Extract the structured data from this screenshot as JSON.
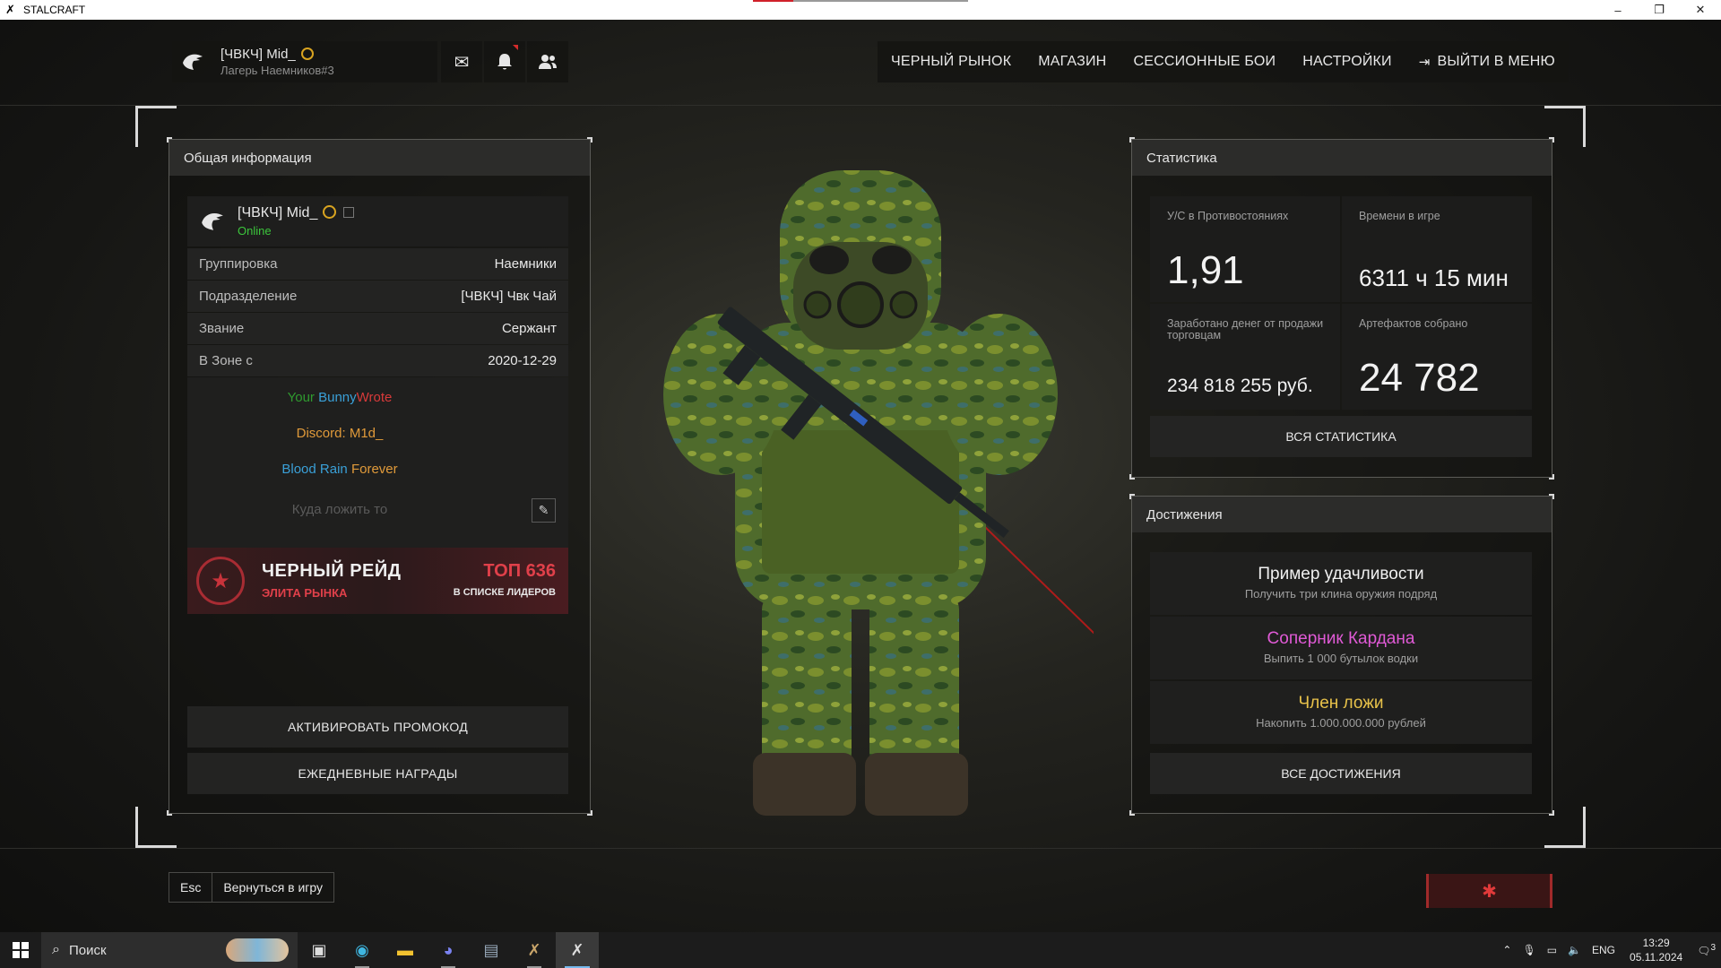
{
  "window": {
    "title": "STALCRAFT",
    "minimize": "–",
    "maximize": "❐",
    "close": "✕"
  },
  "header": {
    "player_name": "[ЧВКЧ] Mid_",
    "location": "Лагерь Наемников#3",
    "nav": [
      "ЧЕРНЫЙ РЫНОК",
      "МАГАЗИН",
      "СЕССИОННЫЕ БОИ",
      "НАСТРОЙКИ",
      "ВЫЙТИ В МЕНЮ"
    ]
  },
  "general": {
    "title": "Общая информация",
    "name": "[ЧВКЧ] Mid_",
    "status": "Online",
    "rows": [
      {
        "k": "Группировка",
        "v": "Наемники"
      },
      {
        "k": "Подразделение",
        "v": "[ЧВКЧ] Чвк Чай"
      },
      {
        "k": "Звание",
        "v": "Сержант"
      },
      {
        "k": "В Зоне с",
        "v": "2020-12-29"
      }
    ],
    "bio": {
      "line1": [
        "Your",
        "Bunny",
        "Wrote"
      ],
      "line2": "Discord: M1d_",
      "line3": [
        "Blood Rain",
        "Forever"
      ],
      "placeholder": "Куда ложить то"
    },
    "raid": {
      "title": "ЧЕРНЫЙ РЕЙД",
      "subtitle": "ЭЛИТА РЫНКА",
      "top": "ТОП 636",
      "top_sub": "В СПИСКЕ ЛИДЕРОВ"
    },
    "promo_button": "АКТИВИРОВАТЬ ПРОМОКОД",
    "daily_button": "ЕЖЕДНЕВНЫЕ НАГРАДЫ"
  },
  "stats": {
    "title": "Статистика",
    "kd_label": "У/С в Противостояниях",
    "kd_value": "1,91",
    "time_label": "Времени в игре",
    "time_value": "6311 ч 15 мин",
    "money_label": "Заработано денег от продажи торговцам",
    "money_value": "234 818 255 руб.",
    "artifacts_label": "Артефактов собрано",
    "artifacts_value": "24 782",
    "all_button": "ВСЯ СТАТИСТИКА"
  },
  "achievements": {
    "title": "Достижения",
    "items": [
      {
        "t": "Пример удачливости",
        "d": "Получить три клина оружия подряд",
        "color": "#f0f0f0"
      },
      {
        "t": "Соперник Кардана",
        "d": "Выпить 1 000 бутылок водки",
        "color": "#e05ad6"
      },
      {
        "t": "Член ложи",
        "d": "Накопить 1.000.000.000 рублей",
        "color": "#e8c24a"
      }
    ],
    "all_button": "ВСЕ ДОСТИЖЕНИЯ"
  },
  "footer": {
    "esc_key": "Esc",
    "return_label": "Вернуться в игру"
  },
  "taskbar": {
    "search_placeholder": "Поиск",
    "lang": "ENG",
    "time": "13:29",
    "date": "05.11.2024",
    "notifications": "3"
  },
  "colors": {
    "online": "#3cc63c",
    "bio_green": "#2f9a2f",
    "bio_blue": "#3aa0d8",
    "bio_red": "#d83a3a",
    "bio_orange": "#e09a3a",
    "raid_red": "#e0404a"
  }
}
